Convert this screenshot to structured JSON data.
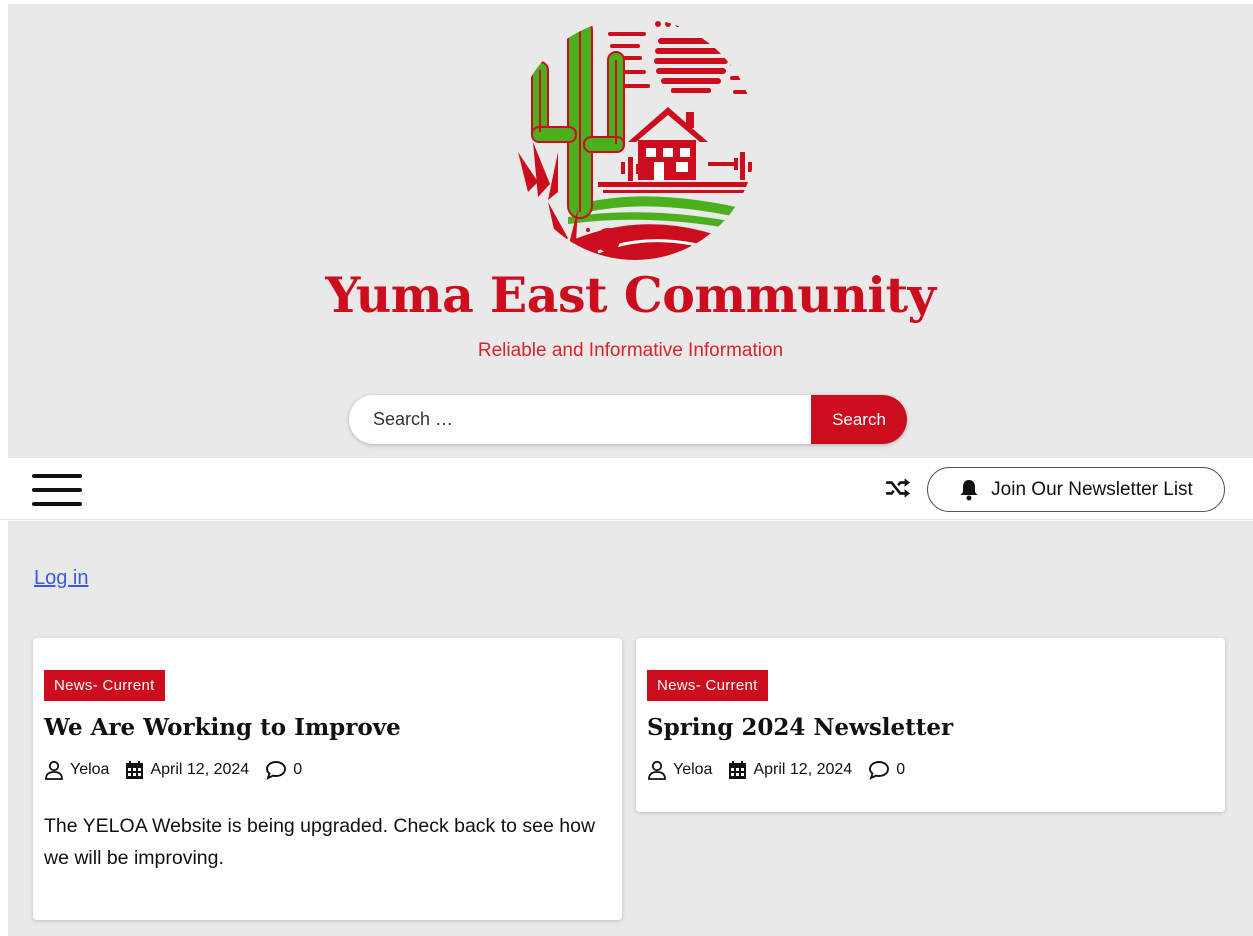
{
  "site": {
    "title": "Yuma East Community",
    "tagline": "Reliable and Informative Information"
  },
  "search": {
    "placeholder": "Search …",
    "button_label": "Search"
  },
  "nav": {
    "newsletter_label": "Join Our Newsletter List"
  },
  "login_label": "Log in",
  "posts": [
    {
      "category": "News- Current",
      "title": "We Are Working to Improve",
      "author": "Yeloa",
      "date": "April 12, 2024",
      "comments": "0",
      "excerpt": "The YELOA Website is being upgraded. Check back to see how we will be improving."
    },
    {
      "category": "News- Current",
      "title": "Spring 2024 Newsletter",
      "author": "Yeloa",
      "date": "April 12, 2024",
      "comments": "0"
    }
  ],
  "colors": {
    "brand_red": "#cc0d1e",
    "logo_green": "#4caf1e",
    "header_bg": "#e9e9e9",
    "link_blue": "#3b5bdb"
  },
  "icons": {
    "menu": "hamburger-icon",
    "shuffle": "shuffle-icon",
    "bell": "bell-icon",
    "author": "user-icon",
    "date": "calendar-icon",
    "comments": "comment-icon"
  }
}
